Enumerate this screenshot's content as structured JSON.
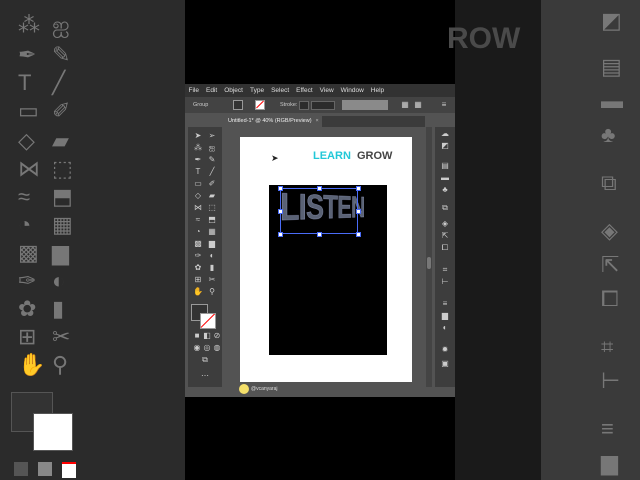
{
  "menu": [
    "File",
    "Edit",
    "Object",
    "Type",
    "Select",
    "Effect",
    "View",
    "Window",
    "Help"
  ],
  "control_bar": {
    "selection_label": "Group",
    "stroke_label": "Stroke:"
  },
  "document_tab": {
    "title": "Untitled-1* @ 40% (RGB/Preview)",
    "close": "×"
  },
  "artwork": {
    "learn": "LEARN",
    "grow": "GROW",
    "listen": "LISTEN",
    "learn_color": "#22c8d8",
    "grow_color": "#444444"
  },
  "background_text": "ROW",
  "user": {
    "handle": "@vcanyaraj"
  },
  "tool_icons": [
    "selection-icon",
    "direct-selection-icon",
    "magic-wand-icon",
    "lasso-icon",
    "pen-icon",
    "curvature-icon",
    "type-icon",
    "line-icon",
    "rectangle-icon",
    "paintbrush-icon",
    "shaper-icon",
    "eraser-icon",
    "rotate-icon",
    "scale-icon",
    "width-icon",
    "free-transform-icon",
    "shape-builder-icon",
    "perspective-icon",
    "mesh-icon",
    "gradient-icon",
    "eyedropper-icon",
    "blend-icon",
    "symbol-sprayer-icon",
    "graph-icon",
    "artboard-icon",
    "slice-icon",
    "hand-icon",
    "zoom-icon"
  ]
}
